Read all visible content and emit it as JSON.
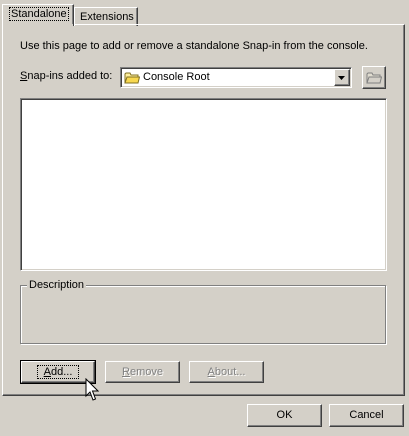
{
  "tabs": [
    {
      "label": "Standalone",
      "active": true
    },
    {
      "label": "Extensions",
      "active": false
    }
  ],
  "intro_text": "Use this page to add or remove a standalone Snap-in from the console.",
  "snapins_label": "Snap-ins added to:",
  "snapins_dropdown": {
    "value": "Console Root",
    "icon": "folder-icon"
  },
  "up_folder_icon": "folder-up-icon",
  "snapin_list": [],
  "description_label": "Description",
  "buttons": {
    "add": "Add...",
    "remove": "Remove",
    "about": "About...",
    "ok": "OK",
    "cancel": "Cancel"
  }
}
